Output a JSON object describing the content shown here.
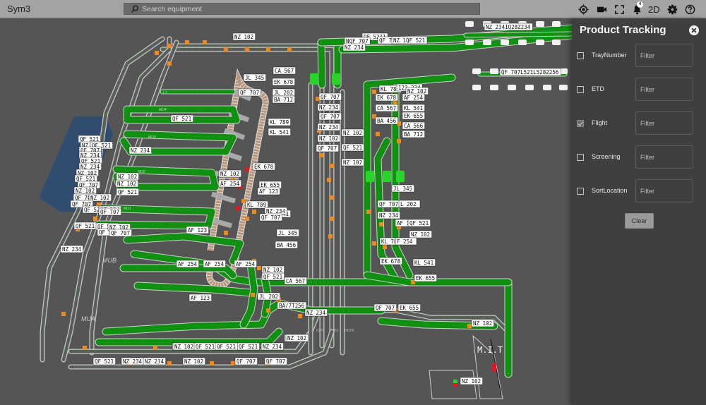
{
  "app": {
    "title": "Sym3",
    "search_placeholder": "Search equipment",
    "notification_count": "4",
    "view_mode_label": "2D",
    "toolbar_icons": [
      "locate-icon",
      "camera-icon",
      "fullscreen-icon",
      "bell-icon",
      "2d-toggle",
      "gear-icon",
      "help-icon"
    ]
  },
  "panel": {
    "title": "Product Tracking",
    "filters": [
      {
        "label": "TrayNumber",
        "checked": false,
        "placeholder": "Filter",
        "value": ""
      },
      {
        "label": "ETD",
        "checked": false,
        "placeholder": "Filter",
        "value": ""
      },
      {
        "label": "Flight",
        "checked": true,
        "placeholder": "Filter",
        "value": ""
      },
      {
        "label": "Screening",
        "checked": false,
        "placeholder": "Filter",
        "value": ""
      },
      {
        "label": "SortLocation",
        "checked": false,
        "placeholder": "Filter",
        "value": ""
      }
    ],
    "clear_label": "Clear"
  },
  "map": {
    "colors": {
      "background": "#555555",
      "conveyor_active": "#109010",
      "conveyor_inactive": "#5f5f5f",
      "rail": "#c8c8c8",
      "tray": "#f08a1c",
      "alarm": "#e8141c",
      "screening": "#2bd42b",
      "carousel": "#b89478",
      "zone": "#2e4d72"
    },
    "zone_labels": [
      "MUB",
      "MUA",
      "MU1",
      "MU2",
      "MU3",
      "MU4",
      "L1"
    ],
    "checkpoint_labels": [
      "ICP1",
      "P2",
      "HCP3"
    ],
    "mit_label": "M.I.T",
    "flight_tags": [
      {
        "text": "NZ 102"
      },
      {
        "text": "QF 5211"
      },
      {
        "text": "NQF 707"
      },
      {
        "text": "QF 707"
      },
      {
        "text": "NZ 1QF 521"
      },
      {
        "text": "NZ 234"
      },
      {
        "text": "NZ 2341Q28Z234"
      },
      {
        "text": "QF 707L521L5282256"
      },
      {
        "text": "JL 345"
      },
      {
        "text": "CA 567"
      },
      {
        "text": "EK 678"
      },
      {
        "text": "QF 707"
      },
      {
        "text": "JL 202"
      },
      {
        "text": "BA 712"
      },
      {
        "text": "QF 521"
      },
      {
        "text": "KL 789"
      },
      {
        "text": "KL 541"
      },
      {
        "text": "EK 678"
      },
      {
        "text": "NZ 102"
      },
      {
        "text": "AF 254"
      },
      {
        "text": "EK 655"
      },
      {
        "text": "AF 123"
      },
      {
        "text": "KL 541"
      },
      {
        "text": "KL 789"
      },
      {
        "text": "NZ 234"
      },
      {
        "text": "QF 707"
      },
      {
        "text": "AF 123"
      },
      {
        "text": "JL 345"
      },
      {
        "text": "BA 456"
      },
      {
        "text": "AF 254"
      },
      {
        "text": "AF 254"
      },
      {
        "text": "AF 254"
      },
      {
        "text": "NZ 102"
      },
      {
        "text": "QF 521"
      },
      {
        "text": "CA 567"
      },
      {
        "text": "AF 123"
      },
      {
        "text": "JL 202"
      },
      {
        "text": "BA/7T256"
      },
      {
        "text": "NZ 102"
      },
      {
        "text": "QF 707"
      },
      {
        "text": "NZ 234"
      },
      {
        "text": "QF 707"
      },
      {
        "text": "NZ 102"
      },
      {
        "text": "NZ 234"
      },
      {
        "text": "QF 521"
      },
      {
        "text": "NZ 102"
      },
      {
        "text": "QF 521"
      },
      {
        "text": "KL 789"
      },
      {
        "text": "123 234"
      },
      {
        "text": "NZ 102"
      },
      {
        "text": "EK 678"
      },
      {
        "text": "AF 254"
      },
      {
        "text": "CA 567"
      },
      {
        "text": "KL 541"
      },
      {
        "text": "EK 655"
      },
      {
        "text": "BA 456"
      },
      {
        "text": "CA 566"
      },
      {
        "text": "BA 712"
      },
      {
        "text": "JL 345"
      },
      {
        "text": "QF 707"
      },
      {
        "text": "L 202"
      },
      {
        "text": "NZ 234"
      },
      {
        "text": "AF 12"
      },
      {
        "text": "QF 521"
      },
      {
        "text": "NZ 102"
      },
      {
        "text": "KL 789"
      },
      {
        "text": "F 254"
      },
      {
        "text": "EK 678"
      },
      {
        "text": "KL 541"
      },
      {
        "text": "EK 655"
      },
      {
        "text": "QF 707"
      },
      {
        "text": "EK 655"
      },
      {
        "text": "NZ 102"
      },
      {
        "text": "NZ 102"
      },
      {
        "text": "QF 521"
      },
      {
        "text": "NZ 234"
      },
      {
        "text": "QF 521"
      },
      {
        "text": "QF 707"
      },
      {
        "text": "NZ 234"
      },
      {
        "text": "QF 521"
      },
      {
        "text": "NZ 234"
      },
      {
        "text": "NZ 102"
      },
      {
        "text": "QF 521"
      },
      {
        "text": "QF 707"
      },
      {
        "text": "NZ 102"
      },
      {
        "text": "QF 707"
      },
      {
        "text": "NZ 102"
      },
      {
        "text": "QF 707"
      },
      {
        "text": "QF 521"
      },
      {
        "text": "NZ 234"
      },
      {
        "text": "QF 707"
      },
      {
        "text": "QF 521"
      },
      {
        "text": "QF 521"
      },
      {
        "text": "QF 521"
      },
      {
        "text": "NZ 234"
      },
      {
        "text": "NZ 102"
      },
      {
        "text": "QF 707"
      },
      {
        "text": "NZ 102"
      },
      {
        "text": "QF 521"
      },
      {
        "text": "NZ 234"
      },
      {
        "text": "NZ 102"
      },
      {
        "text": "QF 521"
      },
      {
        "text": "NZ 234"
      },
      {
        "text": "NZ 234"
      },
      {
        "text": "NZ 102"
      },
      {
        "text": "QF 707"
      },
      {
        "text": "QF 707"
      },
      {
        "text": "NZ 102"
      },
      {
        "text": "QF 521"
      },
      {
        "text": "QF 521"
      },
      {
        "text": "NZ 234"
      },
      {
        "text": "NZ 102"
      },
      {
        "text": "NZ 234"
      },
      {
        "text": "QF 707"
      },
      {
        "text": "NZ 234"
      },
      {
        "text": "QF 707"
      },
      {
        "text": "NZ 234"
      },
      {
        "text": "NZ 102"
      },
      {
        "text": "QF 707"
      },
      {
        "text": "NZ 102"
      },
      {
        "text": "QF 521"
      },
      {
        "text": "NZ 102"
      }
    ]
  }
}
